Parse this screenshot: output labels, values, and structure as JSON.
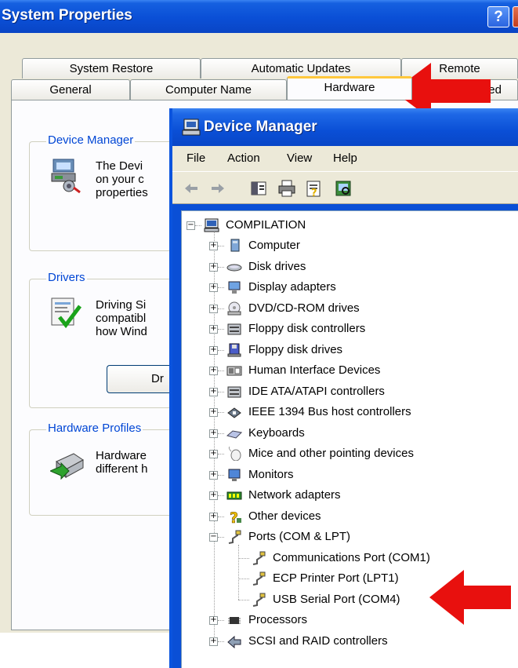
{
  "system_properties": {
    "title": "System Properties",
    "help_button": "?",
    "tabs_row1": [
      "System Restore",
      "Automatic Updates",
      "Remote"
    ],
    "tabs_row2": [
      "General",
      "Computer Name",
      "Hardware",
      "nced"
    ],
    "active_tab": "Hardware",
    "groups": {
      "device_manager": {
        "label": "Device Manager",
        "lines": [
          "The Devi",
          "on your c",
          "properties"
        ]
      },
      "drivers": {
        "label": "Drivers",
        "lines": [
          "Driving Si",
          "compatibl",
          "how Wind"
        ],
        "button_label": "Dr"
      },
      "hardware_profiles": {
        "label": "Hardware Profiles",
        "lines": [
          "Hardware",
          "different h"
        ]
      }
    }
  },
  "device_manager": {
    "title": "Device Manager",
    "menu": [
      "File",
      "Action",
      "View",
      "Help"
    ],
    "toolbar_icons": [
      "back-arrow-icon",
      "forward-arrow-icon",
      "show-hide-console-tree-icon",
      "print-icon",
      "properties-icon",
      "scan-hardware-icon"
    ],
    "root": "COMPILATION",
    "categories": [
      {
        "label": "Computer",
        "icon": "computer-icon"
      },
      {
        "label": "Disk drives",
        "icon": "disk-drive-icon"
      },
      {
        "label": "Display adapters",
        "icon": "display-adapter-icon"
      },
      {
        "label": "DVD/CD-ROM drives",
        "icon": "cdrom-icon"
      },
      {
        "label": "Floppy disk controllers",
        "icon": "floppy-controller-icon"
      },
      {
        "label": "Floppy disk drives",
        "icon": "floppy-drive-icon"
      },
      {
        "label": "Human Interface Devices",
        "icon": "hid-icon"
      },
      {
        "label": "IDE ATA/ATAPI controllers",
        "icon": "ide-controller-icon"
      },
      {
        "label": "IEEE 1394 Bus host controllers",
        "icon": "ieee1394-icon"
      },
      {
        "label": "Keyboards",
        "icon": "keyboard-icon"
      },
      {
        "label": "Mice and other pointing devices",
        "icon": "mouse-icon"
      },
      {
        "label": "Monitors",
        "icon": "monitor-icon"
      },
      {
        "label": "Network adapters",
        "icon": "network-adapter-icon"
      },
      {
        "label": "Other devices",
        "icon": "other-devices-icon"
      },
      {
        "label": "Ports (COM & LPT)",
        "icon": "port-icon",
        "expanded": true,
        "children": [
          "Communications Port (COM1)",
          "ECP Printer Port (LPT1)",
          "USB Serial Port (COM4)"
        ]
      },
      {
        "label": "Processors",
        "icon": "processor-icon"
      },
      {
        "label": "SCSI and RAID controllers",
        "icon": "scsi-icon"
      }
    ]
  },
  "annotations": [
    "red-arrow-icon",
    "red-arrow-icon"
  ],
  "colors": {
    "xp_blue": "#0A4FD6",
    "dialog_bg": "#ECE9D8",
    "group_label": "#0046D5",
    "arrow_red": "#E8100E",
    "tab_highlight": "#FFC83C"
  }
}
